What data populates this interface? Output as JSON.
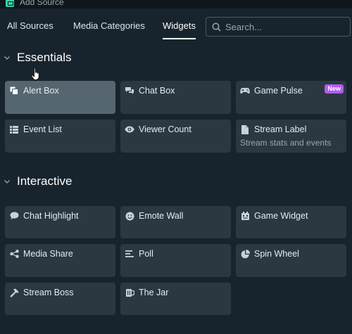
{
  "window": {
    "title": "Add Source",
    "icon": "app-logo-icon"
  },
  "tabs": [
    {
      "label": "All Sources",
      "active": false
    },
    {
      "label": "Media Categories",
      "active": false
    },
    {
      "label": "Widgets",
      "active": true
    }
  ],
  "search": {
    "placeholder": "Search...",
    "value": ""
  },
  "sections": {
    "essentials": {
      "title": "Essentials",
      "items": [
        {
          "label": "Alert Box",
          "icon": "alert-box-icon",
          "selected": true
        },
        {
          "label": "Chat Box",
          "icon": "chat-bubbles-icon"
        },
        {
          "label": "Game Pulse",
          "icon": "gamepad-icon",
          "badge": "New"
        },
        {
          "label": "Event List",
          "icon": "list-icon"
        },
        {
          "label": "Viewer Count",
          "icon": "eye-icon"
        },
        {
          "label": "Stream Label",
          "icon": "document-icon",
          "description": "Stream stats and events"
        }
      ]
    },
    "interactive": {
      "title": "Interactive",
      "items": [
        {
          "label": "Chat Highlight",
          "icon": "chat-highlight-icon"
        },
        {
          "label": "Emote Wall",
          "icon": "smiley-icon"
        },
        {
          "label": "Game Widget",
          "icon": "game-widget-icon"
        },
        {
          "label": "Media Share",
          "icon": "share-icon"
        },
        {
          "label": "Poll",
          "icon": "poll-icon"
        },
        {
          "label": "Spin Wheel",
          "icon": "pie-icon"
        },
        {
          "label": "Stream Boss",
          "icon": "hammer-icon"
        },
        {
          "label": "The Jar",
          "icon": "jar-icon"
        }
      ]
    }
  },
  "colors": {
    "background": "#17242d",
    "tile": "#2b3841",
    "tile_selected": "#566670",
    "badge": "#b25bf2",
    "accent": "#3fd0a9"
  }
}
